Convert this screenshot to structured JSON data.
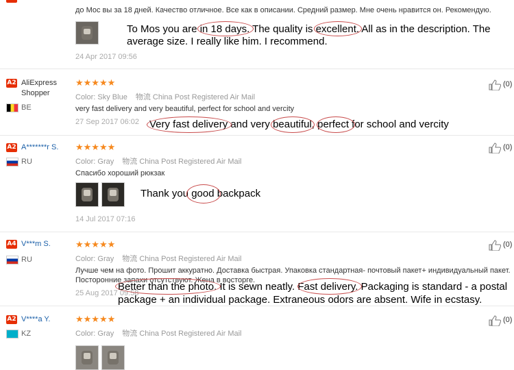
{
  "reviews": [
    {
      "text": "до Мос вы за 18 дней. Качество отличное. Все как в описании. Средний размер. Мне очень нравится он. Рекомендую.",
      "translation": [
        "To Mos you are in 18 days. The quality is excellent. All as in the description. The",
        "average size. I really like him. I recommend."
      ],
      "date": "24 Apr 2017 09:56"
    },
    {
      "level": "A2",
      "name": "AliExpress Shopper",
      "country": "BE",
      "stars": "★★★★★",
      "color_label": "Color:",
      "color_value": "Sky Blue",
      "ship_label": "物流",
      "ship_value": "China Post Registered Air Mail",
      "text": "very fast delivery and very beautiful, perfect for school and vercity",
      "date": "27 Sep 2017 06:02",
      "translation": "Very fast delivery and very beautiful, perfect for school and vercity",
      "likes": "(0)"
    },
    {
      "level": "A2",
      "name": "A*******r S.",
      "country": "RU",
      "stars": "★★★★★",
      "color_label": "Color:",
      "color_value": "Gray",
      "ship_label": "物流",
      "ship_value": "China Post Registered Air Mail",
      "text": "Спасибо хороший рюкзак",
      "translation": "Thank you good backpack",
      "date": "14 Jul 2017 07:16",
      "likes": "(0)"
    },
    {
      "level": "A4",
      "name": "V***m S.",
      "country": "RU",
      "stars": "★★★★★",
      "color_label": "Color:",
      "color_value": "Gray",
      "ship_label": "物流",
      "ship_value": "China Post Registered Air Mail",
      "text1": "Лучше чем на фото. Прошит аккуратно. Доставка быстрая. Упаковка стандартная- почтовый пакет+ индивидуальный пакет.",
      "text2": "Посторонние запахи отсутствуют. Жена в восторге.",
      "date": "25 Aug 2017 09:58",
      "translation": [
        "Better than the photo. It is sewn neatly. Fast delivery. Packaging is standard - a postal",
        "package + an individual package. Extraneous odors are absent. Wife in ecstasy."
      ],
      "likes": "(0)"
    },
    {
      "level": "A2",
      "name": "V****a Y.",
      "country": "KZ",
      "stars": "★★★★★",
      "color_label": "Color:",
      "color_value": "Gray",
      "ship_label": "物流",
      "ship_value": "China Post Registered Air Mail",
      "likes": "(0)"
    }
  ],
  "colors": {
    "stars": "#f6891f",
    "level_badge": "#e62e04",
    "annotation": "#c84a4a",
    "username_blue": "#1a5fa8"
  }
}
